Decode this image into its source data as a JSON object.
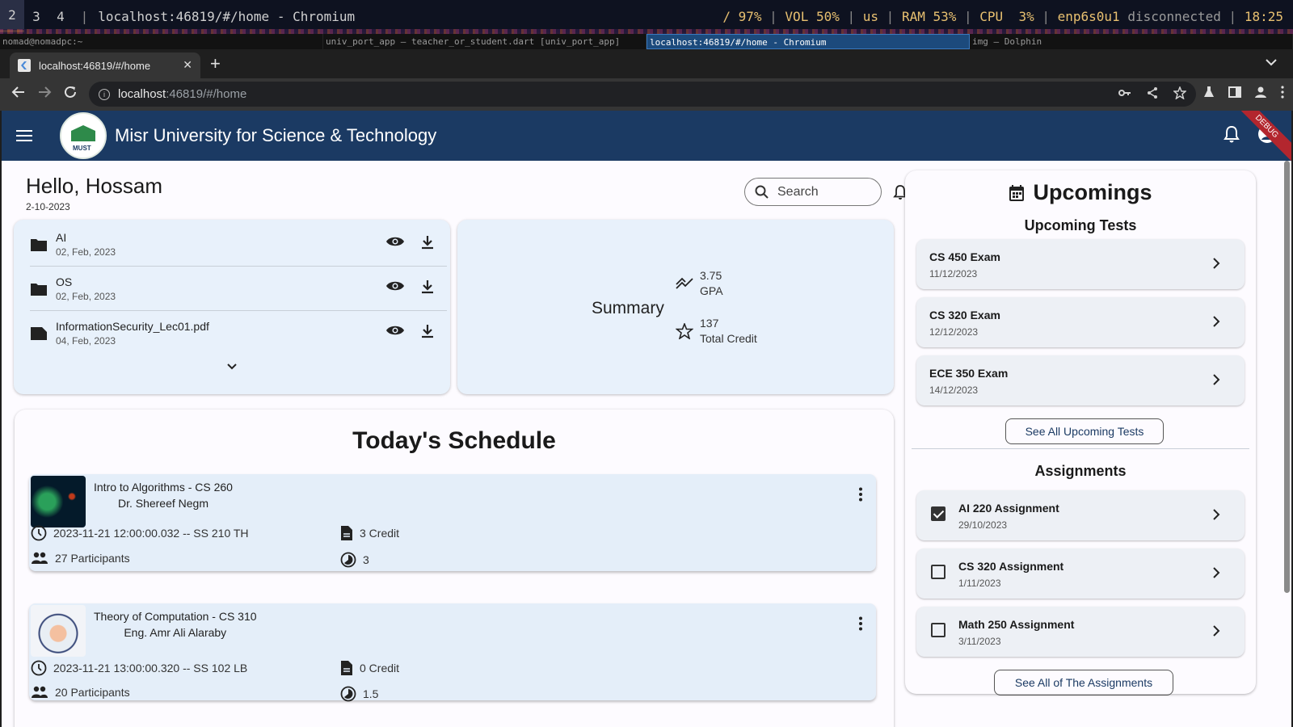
{
  "i3": {
    "workspaces": [
      "2",
      "3",
      "4"
    ],
    "title": "localhost:46819/#/home - Chromium",
    "status": {
      "disk": "/ 97%",
      "vol": "VOL 50%",
      "layout": "us",
      "ram": "RAM 53%",
      "cpu": "CPU  3%",
      "net_iface": "enp6s0u1",
      "net_state": "disconnected",
      "time": "18:25"
    },
    "window_tabs": [
      "nomad@nomadpc:~",
      "univ_port_app – teacher_or_student.dart [univ_port_app]",
      "localhost:46819/#/home - Chromium",
      "img — Dolphin"
    ]
  },
  "browser": {
    "tab_title": "localhost:46819/#/home",
    "url_host": "localhost",
    "url_rest": ":46819/#/home"
  },
  "app": {
    "university": "Misr University for Science & Technology",
    "debug_banner": "DEBUG",
    "greeting": "Hello, Hossam",
    "date": "2-10-2023",
    "search_placeholder": "Search",
    "files": [
      {
        "name": "AI",
        "date": "02, Feb, 2023",
        "icon": "folder-icon"
      },
      {
        "name": "OS",
        "date": "02, Feb, 2023",
        "icon": "folder-icon"
      },
      {
        "name": "InformationSecurity_Lec01.pdf",
        "date": "04, Feb, 2023",
        "icon": "file-icon"
      }
    ],
    "summary": {
      "title": "Summary",
      "gpa_value": "3.75",
      "gpa_label": "GPA",
      "credit_value": "137",
      "credit_label": "Total Credit"
    },
    "schedule": {
      "title": "Today's Schedule",
      "courses": [
        {
          "name": "Intro to Algorithms - CS 260",
          "instructor": "Dr. Shereef Negm",
          "time": "2023-11-21 12:00:00.032 -- SS 210 TH",
          "credit": "3 Credit",
          "participants": "27 Participants",
          "hours": "3"
        },
        {
          "name": "Theory of Computation - CS 310",
          "instructor": "Eng. Amr Ali Alaraby",
          "time": "2023-11-21 13:00:00.320 -- SS 102 LB",
          "credit": "0 Credit",
          "participants": "20 Participants",
          "hours": "1.5"
        }
      ]
    },
    "upcomings": {
      "title": "Upcomings",
      "tests_title": "Upcoming Tests",
      "tests": [
        {
          "name": "CS 450 Exam",
          "date": "11/12/2023"
        },
        {
          "name": "CS 320 Exam",
          "date": "12/12/2023"
        },
        {
          "name": "ECE 350 Exam",
          "date": "14/12/2023"
        }
      ],
      "see_all_tests": "See All Upcoming Tests",
      "assignments_title": "Assignments",
      "assignments": [
        {
          "name": "AI 220 Assignment",
          "date": "29/10/2023",
          "checked": true
        },
        {
          "name": "CS 320 Assignment",
          "date": "1/11/2023",
          "checked": false
        },
        {
          "name": "Math 250 Assignment",
          "date": "3/11/2023",
          "checked": false
        }
      ],
      "see_all_assignments": "See All of The Assignments"
    }
  },
  "colors": {
    "appbar": "#1b3a63",
    "card": "#e8f1fb",
    "accent_text": "#1b3a63"
  }
}
